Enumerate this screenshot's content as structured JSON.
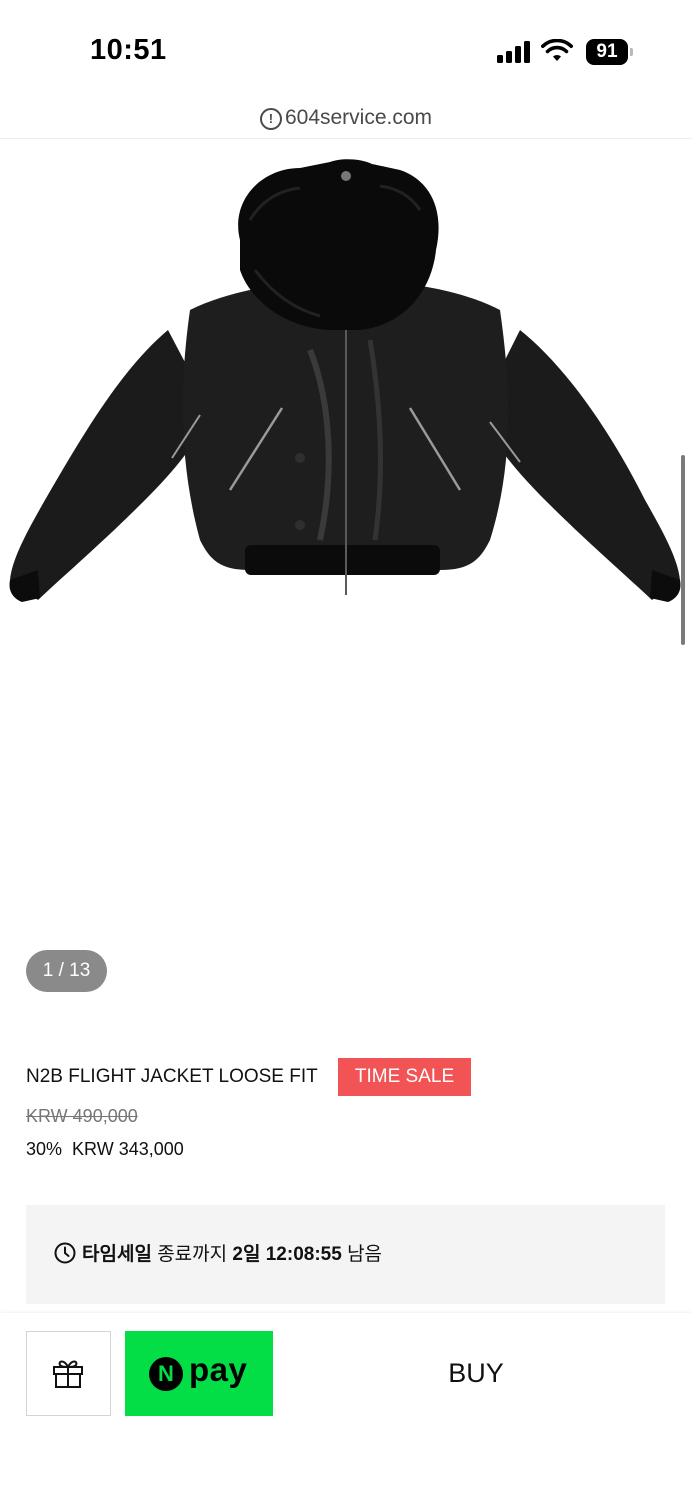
{
  "status_bar": {
    "time": "10:51",
    "battery": "91"
  },
  "browser": {
    "url": "604service.com"
  },
  "gallery": {
    "counter": "1 / 13"
  },
  "product": {
    "name": "N2B FLIGHT JACKET LOOSE FIT",
    "badge": "TIME SALE",
    "original_price": "KRW 490,000",
    "discount": "30%",
    "sale_price": "KRW 343,000"
  },
  "countdown": {
    "label": "타임세일",
    "until": "종료까지",
    "remaining": "2일 12:08:55",
    "suffix": "남음"
  },
  "actions": {
    "npay_mark": "N",
    "npay_label": "pay",
    "buy_label": "BUY"
  },
  "colors": {
    "sale_badge": "#f25355",
    "npay": "#03de46"
  }
}
